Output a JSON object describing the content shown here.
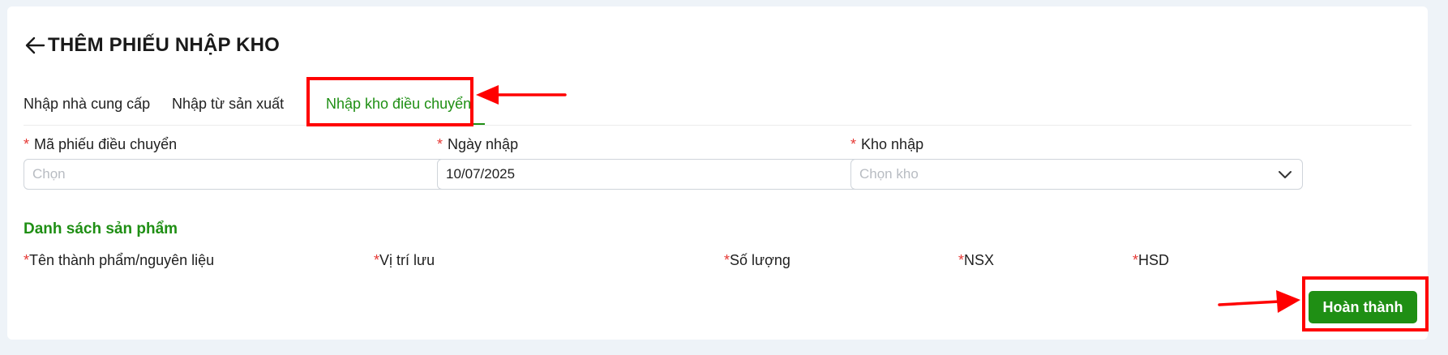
{
  "header": {
    "title": "THÊM PHIẾU NHẬP KHO",
    "back_icon": "arrow-left-icon"
  },
  "tabs": [
    {
      "label": "Nhập nhà cung cấp",
      "active": false
    },
    {
      "label": "Nhập từ sản xuất",
      "active": false
    },
    {
      "label": "Nhập kho điều chuyển",
      "active": true
    }
  ],
  "form": {
    "required_mark": "*",
    "transfer_code": {
      "label": "Mã phiếu điều chuyển",
      "placeholder": "Chọn",
      "icon": "chevron-down-icon"
    },
    "import_date": {
      "label": "Ngày nhập",
      "value": "10/07/2025",
      "icon": "calendar-icon"
    },
    "warehouse": {
      "label": "Kho nhập",
      "placeholder": "Chọn kho",
      "icon": "chevron-down-icon"
    }
  },
  "products": {
    "title": "Danh sách sản phẩm",
    "columns": [
      "Tên thành phẩm/nguyên liệu",
      "Vị trí lưu",
      "Số lượng",
      "NSX",
      "HSD"
    ]
  },
  "actions": {
    "finish_label": "Hoàn thành"
  },
  "colors": {
    "accent": "#1f8f14",
    "annotation": "#ff0000",
    "required": "#e53935"
  }
}
